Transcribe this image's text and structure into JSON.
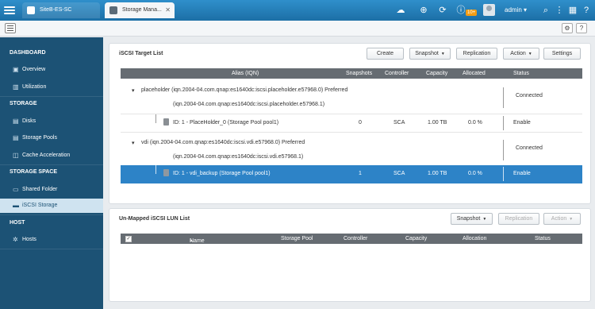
{
  "topbar": {
    "tabs": [
      {
        "label": "SiteB-ES-SC"
      },
      {
        "label": "Storage Mana..."
      }
    ],
    "notification_badge": "10+",
    "user": "admin ▾",
    "accent": "#2f8fcb"
  },
  "sidebar": {
    "sections": [
      {
        "title": "DASHBOARD",
        "items": [
          "Overview",
          "Utilization"
        ]
      },
      {
        "title": "STORAGE",
        "items": [
          "Disks",
          "Storage Pools",
          "Cache Acceleration"
        ]
      },
      {
        "title": "STORAGE SPACE",
        "items": [
          "Shared Folder",
          "iSCSI Storage"
        ]
      },
      {
        "title": "HOST",
        "items": [
          "Hosts"
        ]
      }
    ],
    "active_item": "iSCSI Storage"
  },
  "target_panel": {
    "title": "iSCSI Target List",
    "buttons": {
      "create": "Create",
      "snapshot": "Snapshot",
      "replication": "Replication",
      "action": "Action",
      "settings": "Settings"
    },
    "columns": [
      "Alias (IQN)",
      "Snapshots",
      "Controller",
      "Capacity",
      "Allocated",
      "Status"
    ],
    "targets": [
      {
        "line1": "placeholder (iqn.2004-04.com.qnap:es1640dc:iscsi.placeholder.e57968.0) Preferred",
        "line2": "(iqn.2004-04.com.qnap:es1640dc:iscsi.placeholder.e57968.1)",
        "status": "Connected",
        "lun": {
          "name": "ID: 1 - PlaceHolder_0 (Storage Pool pool1)",
          "snapshots": "0",
          "controller": "SCA",
          "capacity": "1.00 TB",
          "allocated": "0.0 %",
          "status": "Enable"
        }
      },
      {
        "line1": "vdi (iqn.2004-04.com.qnap:es1640dc:iscsi.vdi.e57968.0) Preferred",
        "line2": "(iqn.2004-04.com.qnap:es1640dc:iscsi.vdi.e57968.1)",
        "status": "Connected",
        "lun": {
          "name": "ID: 1 - vdi_backup (Storage Pool pool1)",
          "snapshots": "1",
          "controller": "SCA",
          "capacity": "1.00 TB",
          "allocated": "0.0 %",
          "status": "Enable"
        }
      }
    ]
  },
  "unmapped_panel": {
    "title": "Un-Mapped iSCSI LUN List",
    "buttons": {
      "snapshot": "Snapshot",
      "replication": "Replication",
      "action": "Action"
    },
    "columns": [
      "Name",
      "Storage Pool",
      "Controller",
      "Capacity",
      "Allocation",
      "Status"
    ],
    "check_glyph": "✓",
    "sort_glyph": "▲"
  }
}
